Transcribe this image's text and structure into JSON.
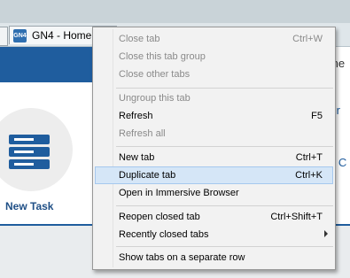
{
  "browser": {
    "active_tab_title": "GN4 - Home",
    "active_tab_favicon": "GN4"
  },
  "app": {
    "new_task_label": "New Task",
    "right_partial_1": "ıne",
    "right_partial_2": "Pr",
    "right_partial_3": "n C"
  },
  "context_menu": {
    "close_tab": {
      "label": "Close tab",
      "shortcut": "Ctrl+W"
    },
    "close_group": {
      "label": "Close this tab group"
    },
    "close_other": {
      "label": "Close other tabs"
    },
    "ungroup": {
      "label": "Ungroup this tab"
    },
    "refresh": {
      "label": "Refresh",
      "shortcut": "F5"
    },
    "refresh_all": {
      "label": "Refresh all"
    },
    "new_tab": {
      "label": "New tab",
      "shortcut": "Ctrl+T"
    },
    "duplicate_tab": {
      "label": "Duplicate tab",
      "shortcut": "Ctrl+K"
    },
    "immersive": {
      "label": "Open in Immersive Browser"
    },
    "reopen_closed": {
      "label": "Reopen closed tab",
      "shortcut": "Ctrl+Shift+T"
    },
    "recently_closed": {
      "label": "Recently closed tabs"
    },
    "separate_row": {
      "label": "Show tabs on a separate row"
    }
  },
  "colors": {
    "accent": "#1f5d9e",
    "highlight": "#d5e6f7"
  }
}
